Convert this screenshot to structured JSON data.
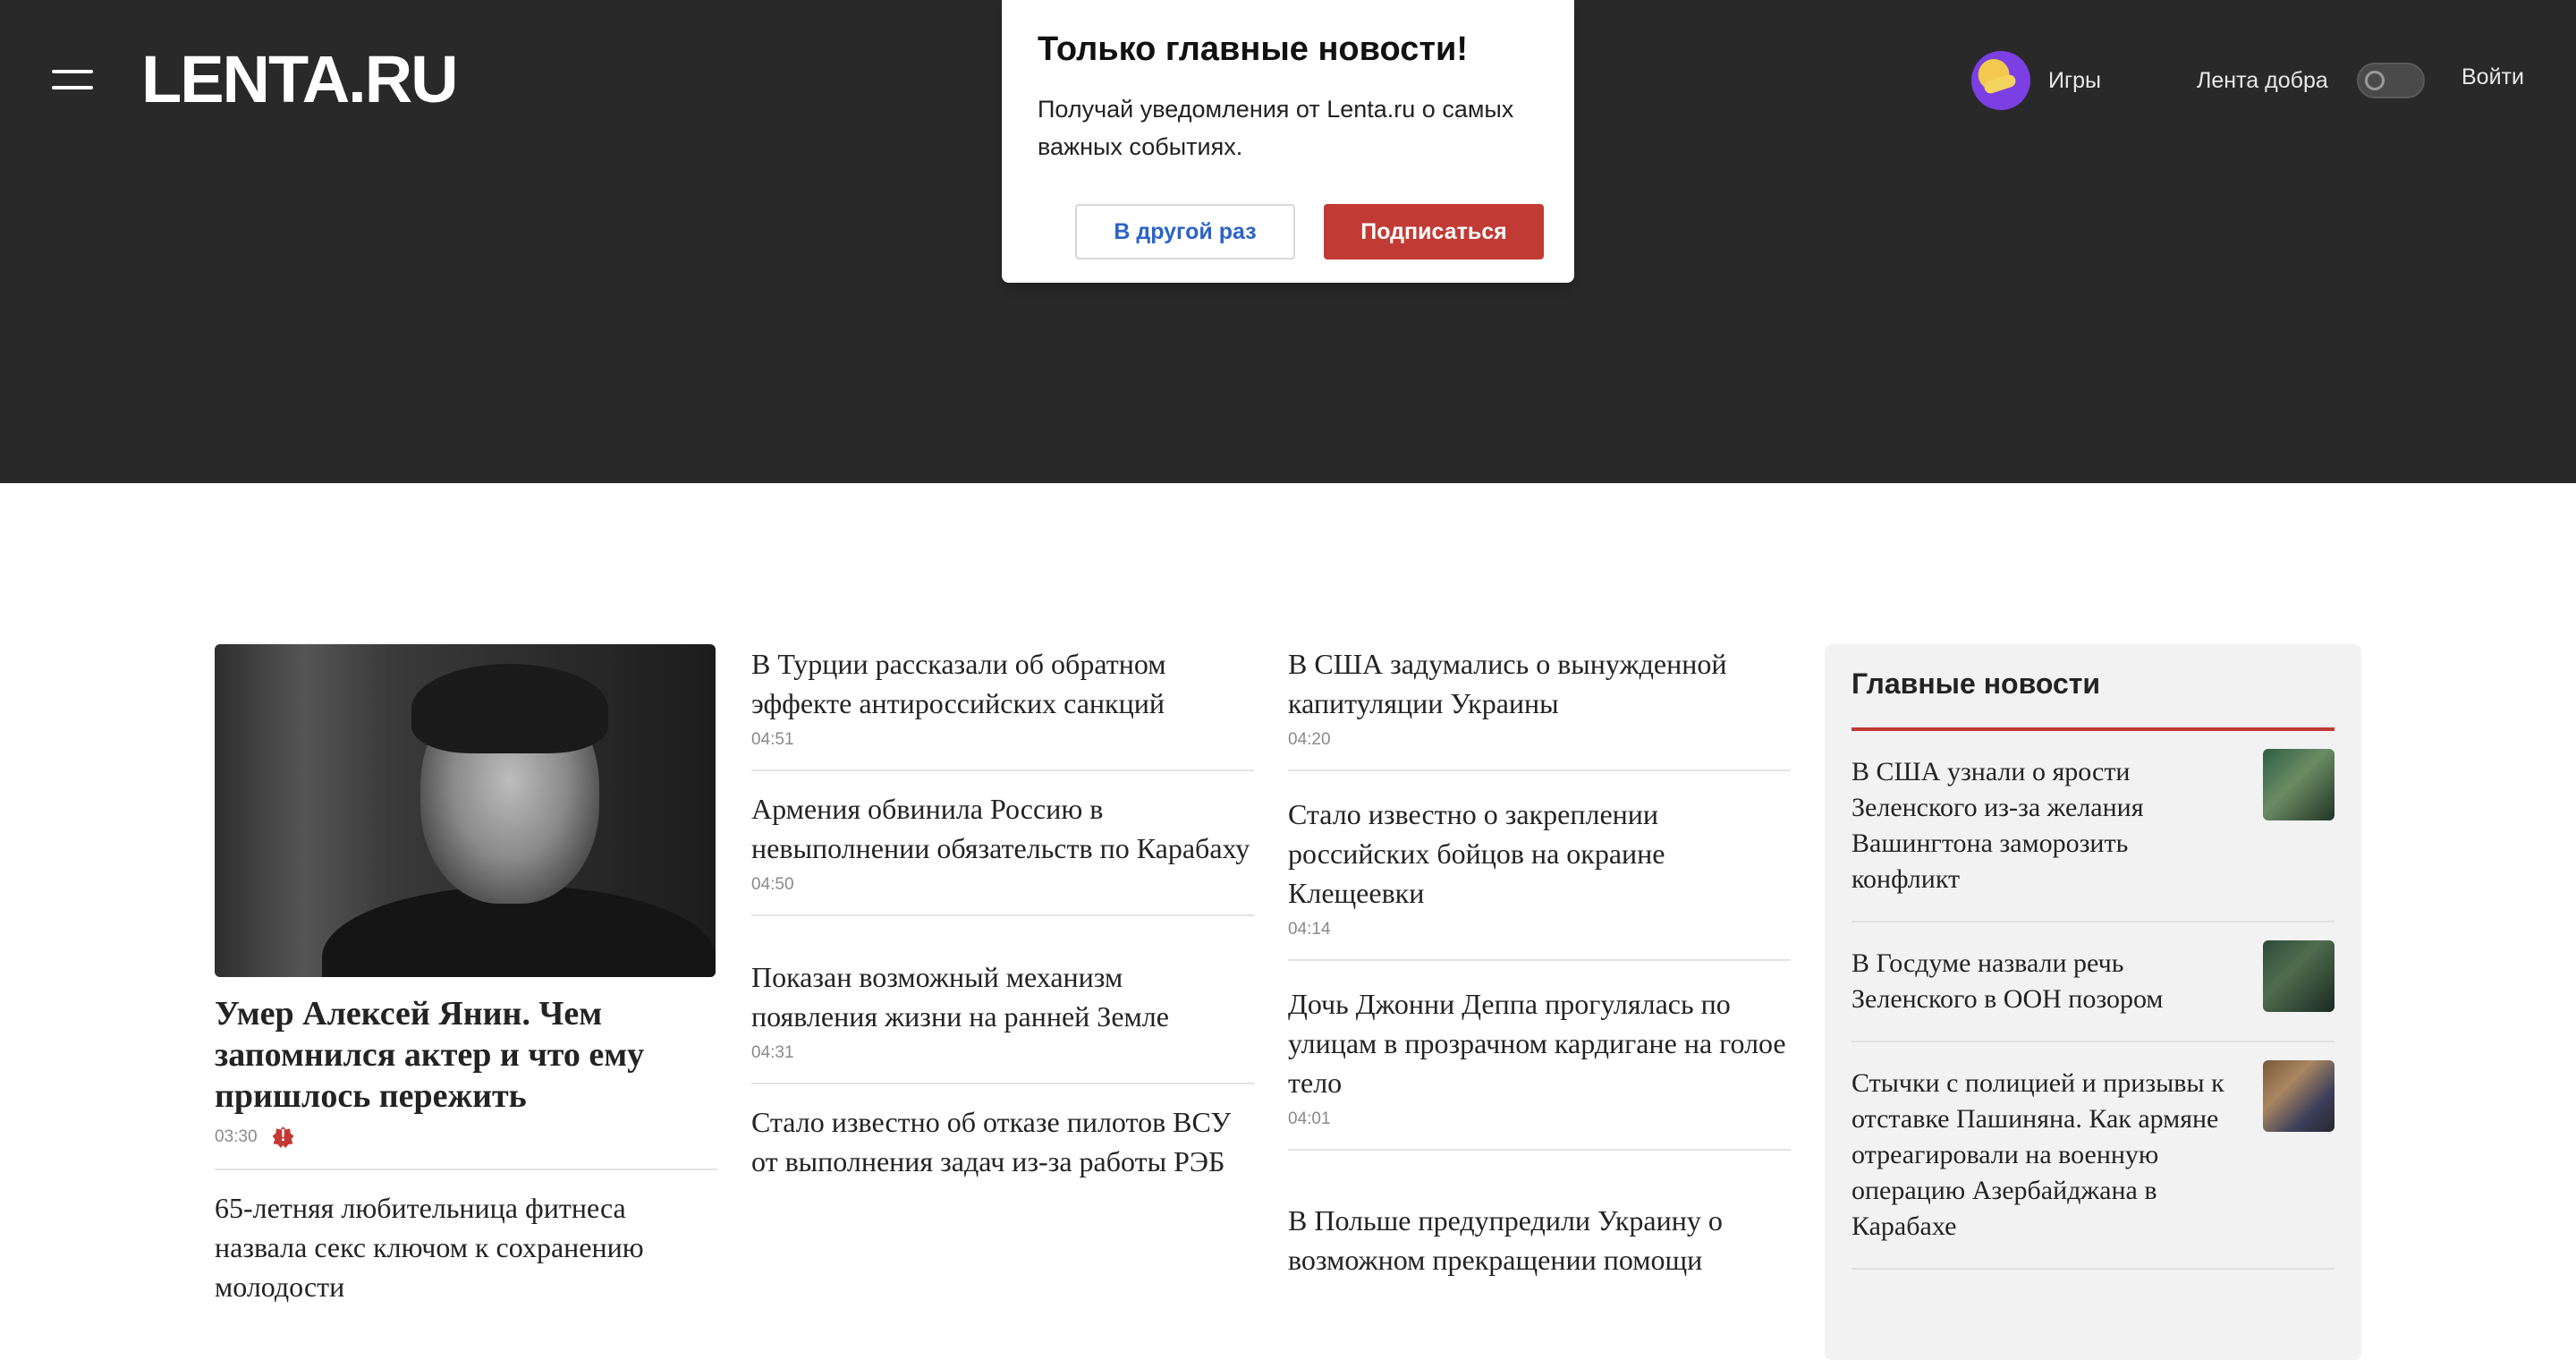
{
  "header": {
    "logo": "LENTA.RU",
    "games_label": "Игры",
    "goodfeed_label": "Лента добра",
    "goodfeed_enabled": false,
    "login_label": "Войти"
  },
  "popup": {
    "title": "Только главные новости!",
    "text": "Получай уведомления от Lenta.ru о самых важных событиях.",
    "later_label": "В другой раз",
    "subscribe_label": "Подписаться"
  },
  "lead": {
    "title": "Умер Алексей Янин. Чем запомнился актер и что ему пришлось пережить",
    "time": "03:30",
    "alert_glyph": "!"
  },
  "col1": [
    {
      "title": "65-летняя любительница фитнеса назвала секс ключом к сохранению молодости"
    }
  ],
  "col2": [
    {
      "title": "В Турции рассказали об обратном эффекте антироссийских санкций",
      "time": "04:51"
    },
    {
      "title": "Армения обвинила Россию в невыполнении обязательств по Карабаху",
      "time": "04:50"
    },
    {
      "title": "Показан возможный механизм появления жизни на ранней Земле",
      "time": "04:31"
    },
    {
      "title": "Стало известно об отказе пилотов ВСУ от выполнения задач из-за работы РЭБ"
    }
  ],
  "col3": [
    {
      "title": "В США задумались о вынужденной капитуляции Украины",
      "time": "04:20"
    },
    {
      "title": "Стало известно о закреплении российских бойцов на окраине Клещеевки",
      "time": "04:14"
    },
    {
      "title": "Дочь Джонни Деппа прогулялась по улицам в прозрачном кардигане на голое тело",
      "time": "04:01"
    },
    {
      "title": "В Польше предупредили Украину о возможном прекращении помощи"
    }
  ],
  "sidebar": {
    "title": "Главные новости",
    "items": [
      {
        "title": "В США узнали о ярости Зеленского из-за желания Вашингтона заморозить конфликт"
      },
      {
        "title": "В Госдуме назвали речь Зеленского в ООН позором"
      },
      {
        "title": "Стычки с полицией и призывы к отставке Пашиняна. Как армяне отреагировали на военную операцию Азербайджана в Карабахе"
      }
    ]
  },
  "colors": {
    "header_bg": "#292929",
    "accent": "#c23a34",
    "link_blue": "#2b63c8"
  }
}
